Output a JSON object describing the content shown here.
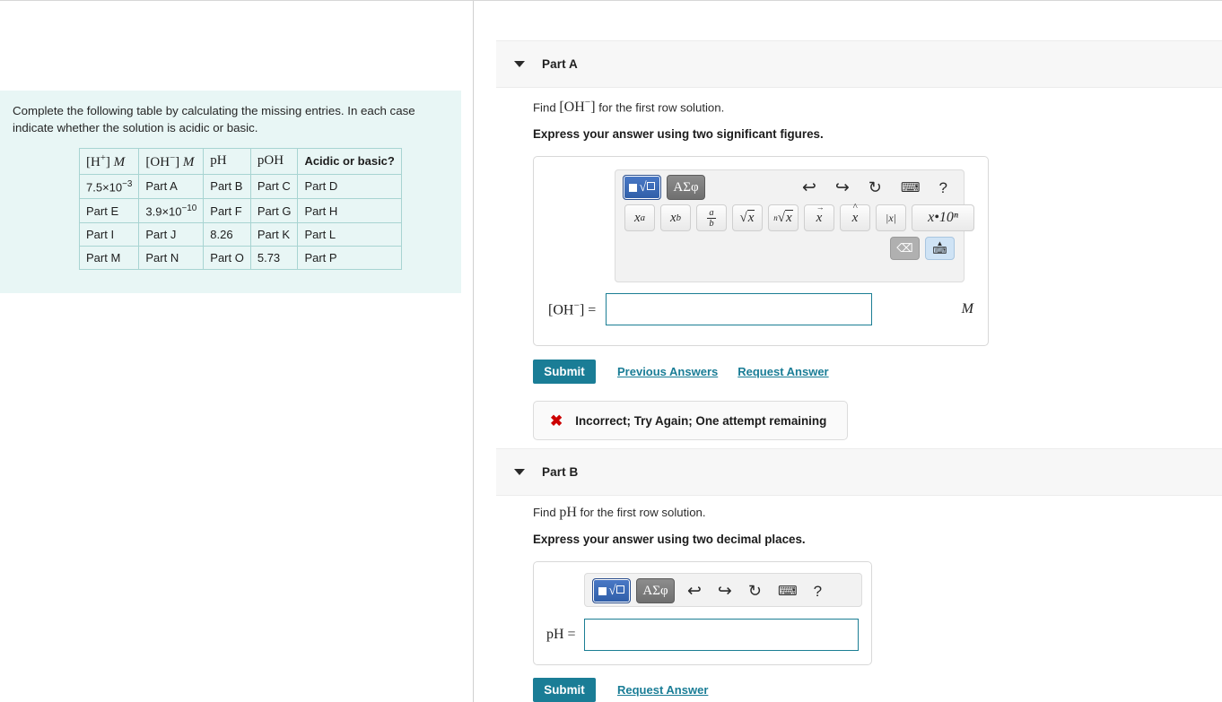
{
  "problem": {
    "statement": "Complete the following table by calculating the missing entries. In each case indicate whether the solution is acidic or basic.",
    "table": {
      "headers": [
        "[H⁺] M",
        "[OH⁻] M",
        "pH",
        "pOH",
        "Acidic or basic?"
      ],
      "rows": [
        [
          "7.5×10⁻³",
          "Part A",
          "Part B",
          "Part C",
          "Part D"
        ],
        [
          "Part E",
          "3.9×10⁻¹⁰",
          "Part F",
          "Part G",
          "Part H"
        ],
        [
          "Part I",
          "Part J",
          "8.26",
          "Part K",
          "Part L"
        ],
        [
          "Part M",
          "Part N",
          "Part O",
          "5.73",
          "Part P"
        ]
      ],
      "cells": {
        "r0c0_base": "7.5×10",
        "r0c0_exp": "−3",
        "r1c1_base": "3.9×10",
        "r1c1_exp": "−10",
        "r2c2": "8.26",
        "r3c3": "5.73"
      }
    }
  },
  "partA": {
    "title": "Part A",
    "prompt_pre": "Find ",
    "prompt_math": "[OH⁻]",
    "prompt_post": " for the first row solution.",
    "instruction": "Express your answer using two significant figures.",
    "input_label": "[OH⁻] =",
    "input_value": "",
    "input_placeholder": "",
    "unit": "M",
    "submit_label": "Submit",
    "previous_answers_label": "Previous Answers",
    "request_answer_label": "Request Answer",
    "feedback": "Incorrect; Try Again; One attempt remaining",
    "feedback_icon": "✖"
  },
  "partB": {
    "title": "Part B",
    "prompt_pre": "Find ",
    "prompt_math": "pH",
    "prompt_post": " for the first row solution.",
    "instruction": "Express your answer using two decimal places.",
    "input_label": "pH =",
    "input_value": "",
    "input_placeholder": "",
    "submit_label": "Submit",
    "request_answer_label": "Request Answer"
  },
  "mathbar": {
    "mode_template_label": "√□",
    "mode_greek_label": "ΑΣφ",
    "icons": {
      "undo": "↶",
      "redo": "↷",
      "reset": "↺",
      "keyboard": "⌨",
      "help": "?"
    },
    "symbols": [
      {
        "name": "superscript",
        "label": "xᵃ"
      },
      {
        "name": "subscript",
        "label": "xᵇ"
      },
      {
        "name": "fraction",
        "num": "a",
        "den": "b"
      },
      {
        "name": "square-root",
        "label": "√x"
      },
      {
        "name": "nth-root",
        "label": "ⁿ√x"
      },
      {
        "name": "vector",
        "label": "x⃗"
      },
      {
        "name": "unit-vector",
        "label": "x̂"
      },
      {
        "name": "absolute-value",
        "label": "|x|"
      },
      {
        "name": "scientific-notation",
        "label": "x•10ⁿ"
      }
    ],
    "backspace": "⌫",
    "keyboard_toggle": "⌨"
  },
  "colors": {
    "accent": "#1a7d96",
    "problem_bg": "#e8f6f5",
    "header_bg": "#f7f7f7",
    "error": "#cc0000"
  }
}
